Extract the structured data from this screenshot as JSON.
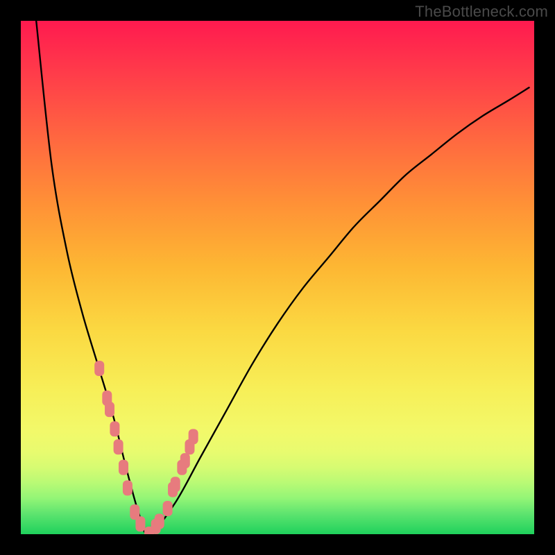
{
  "watermark": "TheBottleneck.com",
  "colors": {
    "page_bg": "#000000",
    "gradient_top": "#ff1a4f",
    "gradient_bottom": "#1fd15c",
    "curve": "#000000",
    "marker_fill": "#e77b7e",
    "marker_stroke": "#d66a6d"
  },
  "chart_data": {
    "type": "line",
    "title": "",
    "xlabel": "",
    "ylabel": "",
    "xlim": [
      0,
      100
    ],
    "ylim": [
      0,
      100
    ],
    "legend": false,
    "grid": false,
    "series": [
      {
        "name": "bottleneck-curve",
        "x": [
          3,
          6,
          9,
          12,
          15,
          18,
          20.5,
          23,
          25,
          30,
          35,
          40,
          45,
          50,
          55,
          60,
          65,
          70,
          75,
          80,
          85,
          90,
          95,
          99
        ],
        "y": [
          100,
          72,
          55,
          43,
          33,
          23,
          13,
          4,
          0,
          6,
          15,
          24,
          33,
          41,
          48,
          54,
          60,
          65,
          70,
          74,
          78,
          81.5,
          84.5,
          87
        ]
      }
    ],
    "markers": {
      "name": "highlighted-points",
      "x": [
        15.3,
        16.8,
        17.3,
        18.3,
        19.0,
        20.0,
        20.8,
        22.2,
        23.3,
        25.0,
        26.3,
        27.0,
        28.6,
        29.6,
        30.1,
        31.4,
        32.0,
        32.9,
        33.6
      ],
      "y": [
        32.3,
        26.5,
        24.3,
        20.5,
        17.0,
        13.0,
        9.0,
        4.3,
        2.0,
        0.0,
        1.5,
        2.5,
        5.0,
        8.7,
        9.7,
        13.0,
        14.3,
        17.0,
        19.0
      ]
    }
  }
}
